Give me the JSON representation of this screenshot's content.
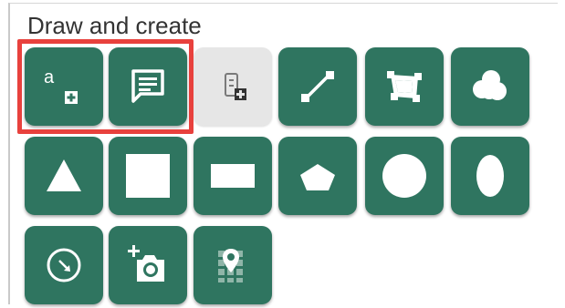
{
  "panel": {
    "title": "Draw and create"
  },
  "buttons": {
    "row1": [
      "text-label",
      "note",
      "add-column",
      "line",
      "quadrilateral",
      "cloud"
    ],
    "row2": [
      "triangle",
      "square",
      "rectangle",
      "pentagon",
      "circle",
      "ellipse"
    ],
    "row3": [
      "rotate-circle",
      "add-photo",
      "map-grid"
    ]
  },
  "text_label_button": {
    "glyph": "a"
  },
  "colors": {
    "button": "#2f7560",
    "button_disabled": "#e6e6e6",
    "highlight": "#e8413d",
    "icon": "#ffffff"
  }
}
